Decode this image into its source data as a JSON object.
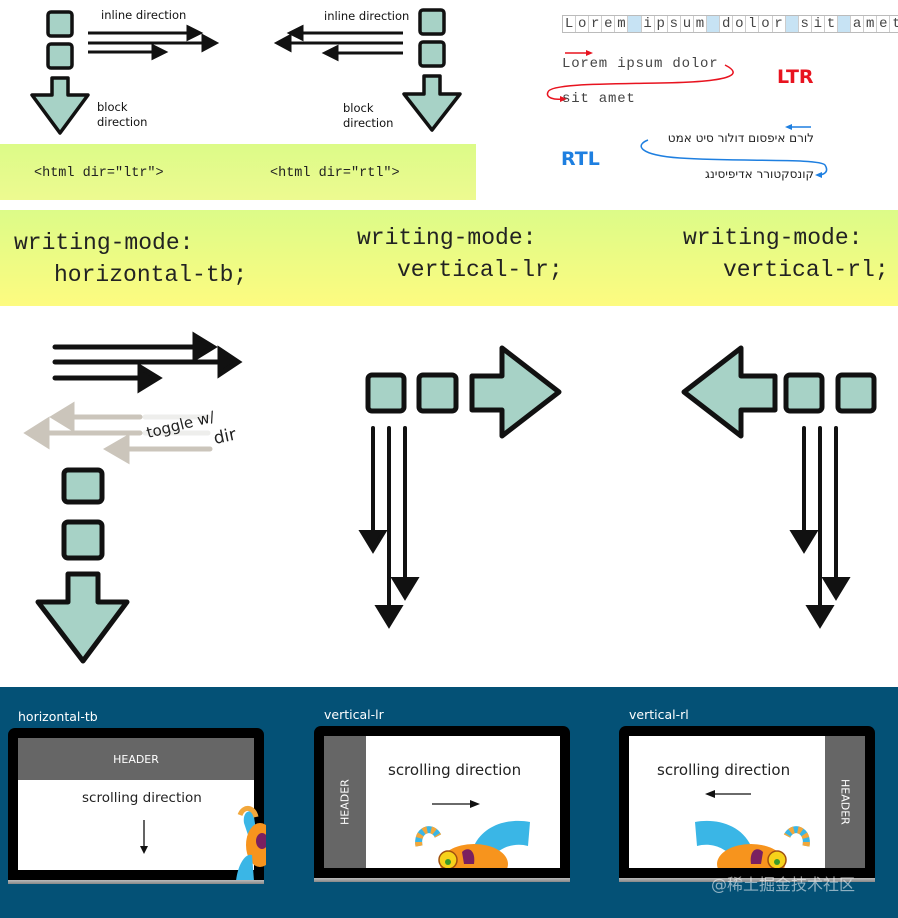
{
  "direction_diagram": {
    "ltr": {
      "inline_label": "inline direction",
      "block_label_line1": "block",
      "block_label_line2": "direction"
    },
    "rtl": {
      "inline_label": "inline direction",
      "block_label_line1": "block",
      "block_label_line2": "direction"
    },
    "code_ltr": "<html dir=\"ltr\">",
    "code_rtl": "<html dir=\"rtl\">"
  },
  "text_example": {
    "grid_words": [
      "Lorem",
      "ipsum",
      "dolor",
      "sit",
      "amet"
    ],
    "ltr_line1": "Lorem ipsum dolor",
    "ltr_line2": "sit amet",
    "ltr_tag": "LTR",
    "rtl_line1": "לורם איפסום דולור סיט אמט",
    "rtl_line2": "קונסקטורר אדיפיסינג",
    "rtl_tag": "RTL",
    "ltr_color": "#e8131f",
    "rtl_color": "#1e7fe0"
  },
  "writing_modes": [
    {
      "line1": "writing-mode:",
      "line2": "horizontal-tb;"
    },
    {
      "line1": "writing-mode:",
      "line2": "vertical-lr;"
    },
    {
      "line1": "writing-mode:",
      "line2": "vertical-rl;"
    }
  ],
  "sketch": {
    "toggle_label_line1": "toggle w/",
    "toggle_label_line2": "dir",
    "box_color": "#a7d2c6"
  },
  "laptops": [
    {
      "title": "horizontal-tb",
      "header": "HEADER",
      "scroll_label": "scrolling direction",
      "arrow": "down"
    },
    {
      "title": "vertical-lr",
      "header": "HEADER",
      "scroll_label": "scrolling direction",
      "arrow": "right"
    },
    {
      "title": "vertical-rl",
      "header": "HEADER",
      "scroll_label": "scrolling direction",
      "arrow": "left"
    }
  ],
  "watermark": "@稀土掘金技术社区"
}
